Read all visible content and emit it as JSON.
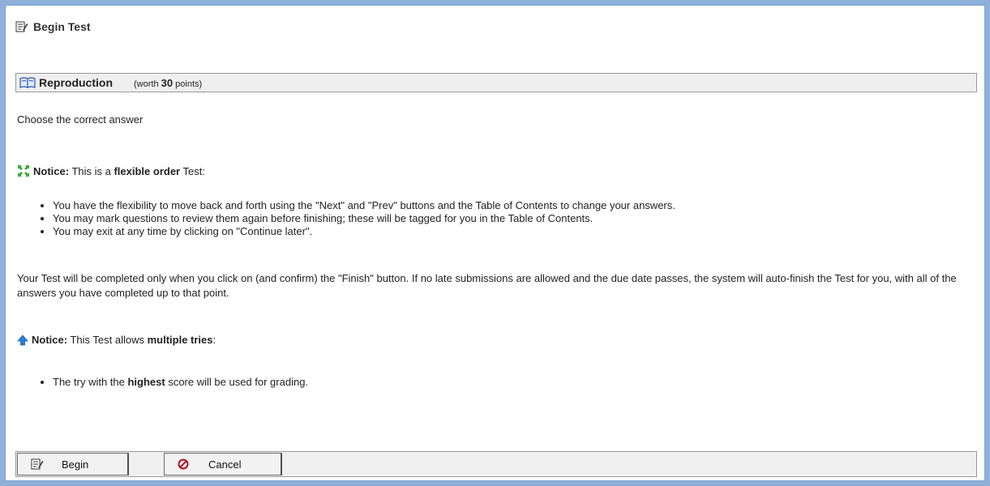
{
  "header": {
    "title": "Begin Test",
    "icon": "edit-document-icon"
  },
  "section": {
    "title": "Reproduction",
    "worth_prefix": "(worth ",
    "worth_points": "30",
    "worth_suffix": " points)",
    "icon": "open-book-icon"
  },
  "instructions": "Choose the correct answer",
  "notice1": {
    "label": "Notice:",
    "text_before": "This is a ",
    "emphasis": "flexible order",
    "text_after": " Test:",
    "icon": "flexible-order-icon",
    "bullets": [
      "You have the flexibility to move back and forth using the \"Next\" and \"Prev\" buttons and the Table of Contents to change your answers.",
      "You may mark questions to review them again before finishing; these will be tagged for you in the Table of Contents.",
      "You may exit at any time by clicking on \"Continue later\"."
    ]
  },
  "completion_paragraph": "Your Test will be completed only when you click on (and confirm) the \"Finish\" button. If no late submissions are allowed and the due date passes, the system will auto-finish the Test for you, with all of the answers you have completed up to that point.",
  "notice2": {
    "label": "Notice:",
    "text_before": "This Test allows ",
    "emphasis": "multiple tries",
    "text_after": ":",
    "icon": "up-arrow-icon",
    "bullet_before": "The try with the ",
    "bullet_emphasis": "highest",
    "bullet_after": " score will be used for grading."
  },
  "buttons": {
    "begin": {
      "label": "Begin",
      "icon": "edit-document-icon"
    },
    "cancel": {
      "label": "Cancel",
      "icon": "cancel-icon"
    }
  },
  "colors": {
    "page_border": "#8fb0d9",
    "bar_background": "#efefef",
    "cancel_icon": "#b0102a",
    "notice_arrow": "#2a7fd4",
    "flex_icon": "#3aa63a"
  }
}
